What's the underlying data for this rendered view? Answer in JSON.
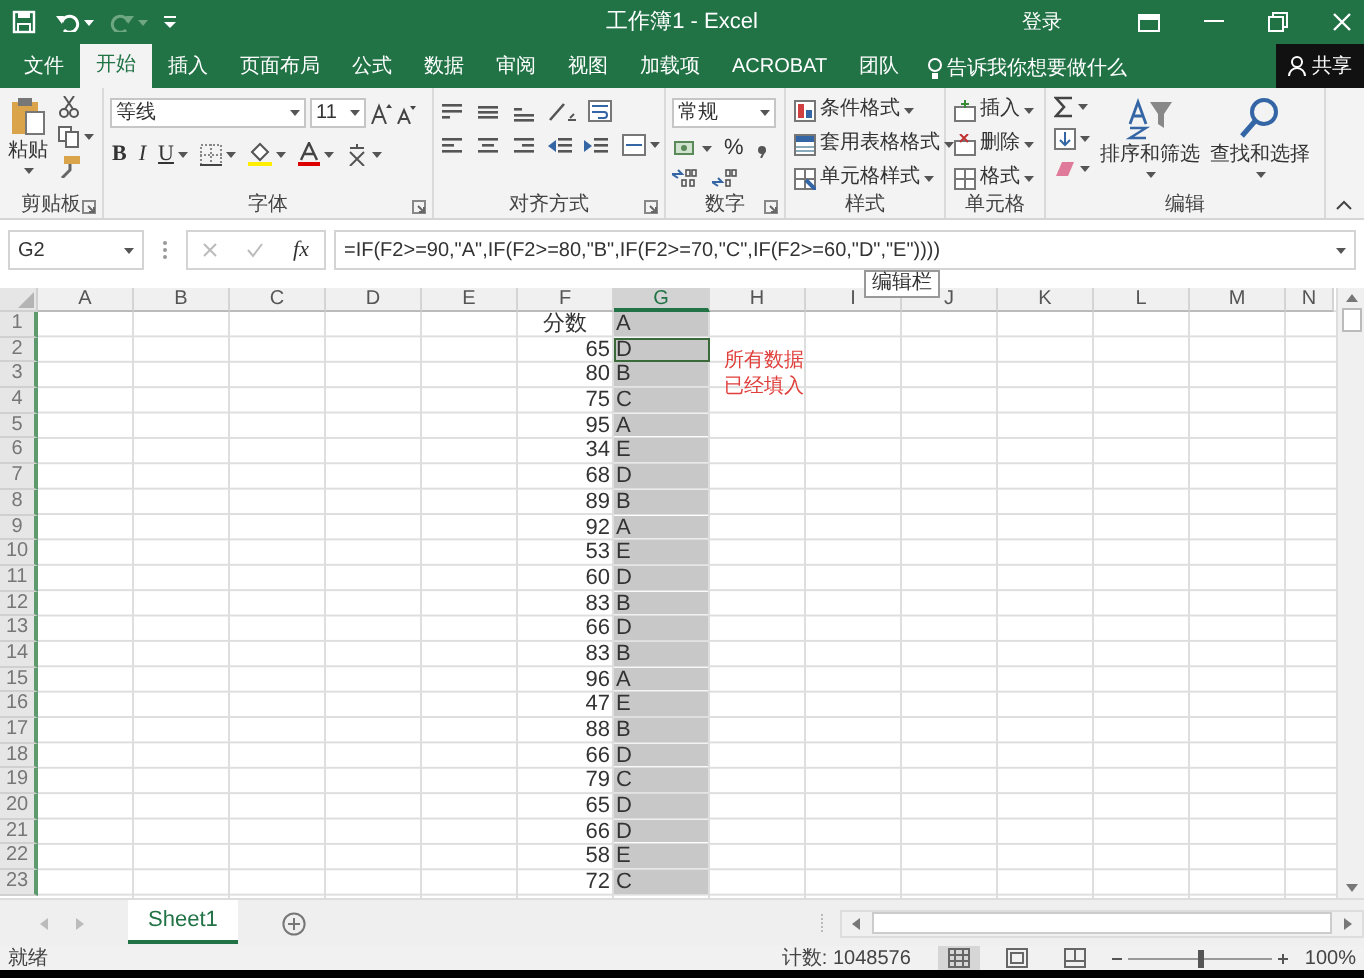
{
  "title_bar": {
    "title": "工作簿1  -  Excel",
    "sign_in": "登录"
  },
  "tabs": [
    {
      "label": "文件",
      "selected": false
    },
    {
      "label": "开始",
      "selected": true
    },
    {
      "label": "插入",
      "selected": false
    },
    {
      "label": "页面布局",
      "selected": false
    },
    {
      "label": "公式",
      "selected": false
    },
    {
      "label": "数据",
      "selected": false
    },
    {
      "label": "审阅",
      "selected": false
    },
    {
      "label": "视图",
      "selected": false
    },
    {
      "label": "加载项",
      "selected": false
    },
    {
      "label": "ACROBAT",
      "selected": false
    },
    {
      "label": "团队",
      "selected": false
    }
  ],
  "tell_me": "告诉我你想要做什么",
  "share_button": "共享",
  "ribbon": [
    {
      "kind": "clipboard",
      "label": "剪贴板",
      "texts": [
        "粘贴"
      ]
    },
    {
      "kind": "font",
      "label": "字体",
      "texts": [
        "等线",
        "11",
        "B",
        "I",
        "U"
      ]
    },
    {
      "kind": "alignment",
      "label": "对齐方式"
    },
    {
      "kind": "number",
      "label": "数字",
      "texts": [
        "常规",
        "%"
      ]
    },
    {
      "kind": "styles",
      "label": "样式",
      "texts": [
        "条件格式",
        "套用表格格式",
        "单元格样式"
      ]
    },
    {
      "kind": "cells",
      "label": "单元格",
      "texts": [
        "插入",
        "删除",
        "格式"
      ]
    },
    {
      "kind": "editing",
      "label": "编辑",
      "texts": [
        "排序和筛选",
        "查找和选择"
      ]
    }
  ],
  "formula_bar": {
    "name_box": "G2",
    "function_button": "fx",
    "formula": "=IF(F2>=90,\"A\",IF(F2>=80,\"B\",IF(F2>=70,\"C\",IF(F2>=60,\"D\",\"E\"))))"
  },
  "tooltip": "编辑栏",
  "columns": [
    {
      "label": "A",
      "selected": false
    },
    {
      "label": "B",
      "selected": false
    },
    {
      "label": "C",
      "selected": false
    },
    {
      "label": "D",
      "selected": false
    },
    {
      "label": "E",
      "selected": false
    },
    {
      "label": "F",
      "selected": false
    },
    {
      "label": "G",
      "selected": true
    },
    {
      "label": "H",
      "selected": false
    },
    {
      "label": "I",
      "selected": false
    },
    {
      "label": "J",
      "selected": false
    },
    {
      "label": "K",
      "selected": false
    },
    {
      "label": "L",
      "selected": false
    },
    {
      "label": "M",
      "selected": false
    },
    {
      "label": "N",
      "selected": false
    }
  ],
  "rows": [
    {
      "header": "1",
      "score": "分数",
      "grade": "A",
      "active": false
    },
    {
      "header": "2",
      "score": "65",
      "grade": "D",
      "active": true
    },
    {
      "header": "3",
      "score": "80",
      "grade": "B",
      "active": false
    },
    {
      "header": "4",
      "score": "75",
      "grade": "C",
      "active": false
    },
    {
      "header": "5",
      "score": "95",
      "grade": "A",
      "active": false
    },
    {
      "header": "6",
      "score": "34",
      "grade": "E",
      "active": false
    },
    {
      "header": "7",
      "score": "68",
      "grade": "D",
      "active": false
    },
    {
      "header": "8",
      "score": "89",
      "grade": "B",
      "active": false
    },
    {
      "header": "9",
      "score": "92",
      "grade": "A",
      "active": false
    },
    {
      "header": "10",
      "score": "53",
      "grade": "E",
      "active": false
    },
    {
      "header": "11",
      "score": "60",
      "grade": "D",
      "active": false
    },
    {
      "header": "12",
      "score": "83",
      "grade": "B",
      "active": false
    },
    {
      "header": "13",
      "score": "66",
      "grade": "D",
      "active": false
    },
    {
      "header": "14",
      "score": "83",
      "grade": "B",
      "active": false
    },
    {
      "header": "15",
      "score": "96",
      "grade": "A",
      "active": false
    },
    {
      "header": "16",
      "score": "47",
      "grade": "E",
      "active": false
    },
    {
      "header": "17",
      "score": "88",
      "grade": "B",
      "active": false
    },
    {
      "header": "18",
      "score": "66",
      "grade": "D",
      "active": false
    },
    {
      "header": "19",
      "score": "79",
      "grade": "C",
      "active": false
    },
    {
      "header": "20",
      "score": "65",
      "grade": "D",
      "active": false
    },
    {
      "header": "21",
      "score": "66",
      "grade": "D",
      "active": false
    },
    {
      "header": "22",
      "score": "58",
      "grade": "E",
      "active": false
    },
    {
      "header": "23",
      "score": "72",
      "grade": "C",
      "active": false
    }
  ],
  "note": {
    "lines": [
      "所有数据",
      "已经填入"
    ],
    "color": "#e0403c"
  },
  "sheet_tabs": [
    {
      "label": "Sheet1",
      "selected": true
    }
  ],
  "status_bar": {
    "status": "就绪",
    "count": "计数: 1048576",
    "views": [
      {
        "kind": "normal",
        "selected": true
      },
      {
        "kind": "page-layout",
        "selected": false
      },
      {
        "kind": "page-break",
        "selected": false
      }
    ],
    "zoom": {
      "level": 0.5,
      "reading": "100%"
    }
  }
}
